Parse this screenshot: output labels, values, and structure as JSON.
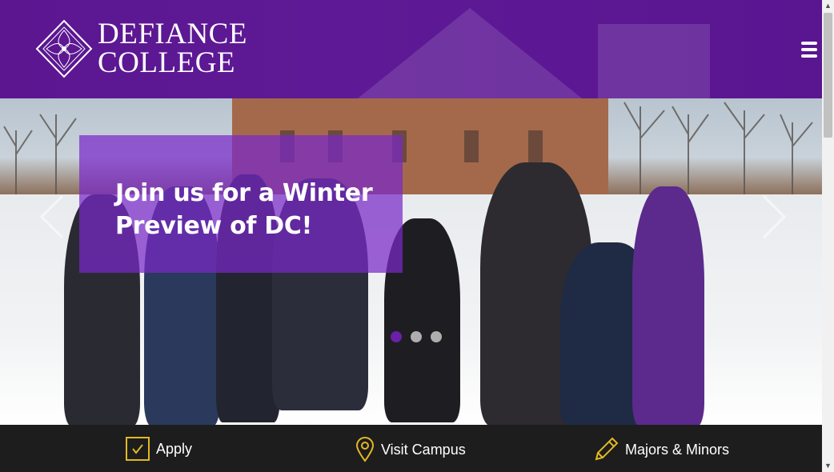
{
  "header": {
    "logo_line1": "DEFIANCE",
    "logo_line2": "COLLEGE",
    "brand_color": "#5b1690",
    "menu_icon": "hamburger-menu-icon"
  },
  "hero": {
    "caption": "Join us for a Winter Preview of DC!",
    "slides_total": 3,
    "active_slide": 1,
    "prev_icon": "chevron-left-icon",
    "next_icon": "chevron-right-icon"
  },
  "bottom_bar": {
    "items": [
      {
        "label": "Apply",
        "icon": "checkbox-icon"
      },
      {
        "label": "Visit Campus",
        "icon": "map-pin-icon"
      },
      {
        "label": "Majors & Minors",
        "icon": "pencil-icon"
      }
    ],
    "icon_color": "#e3b823"
  }
}
